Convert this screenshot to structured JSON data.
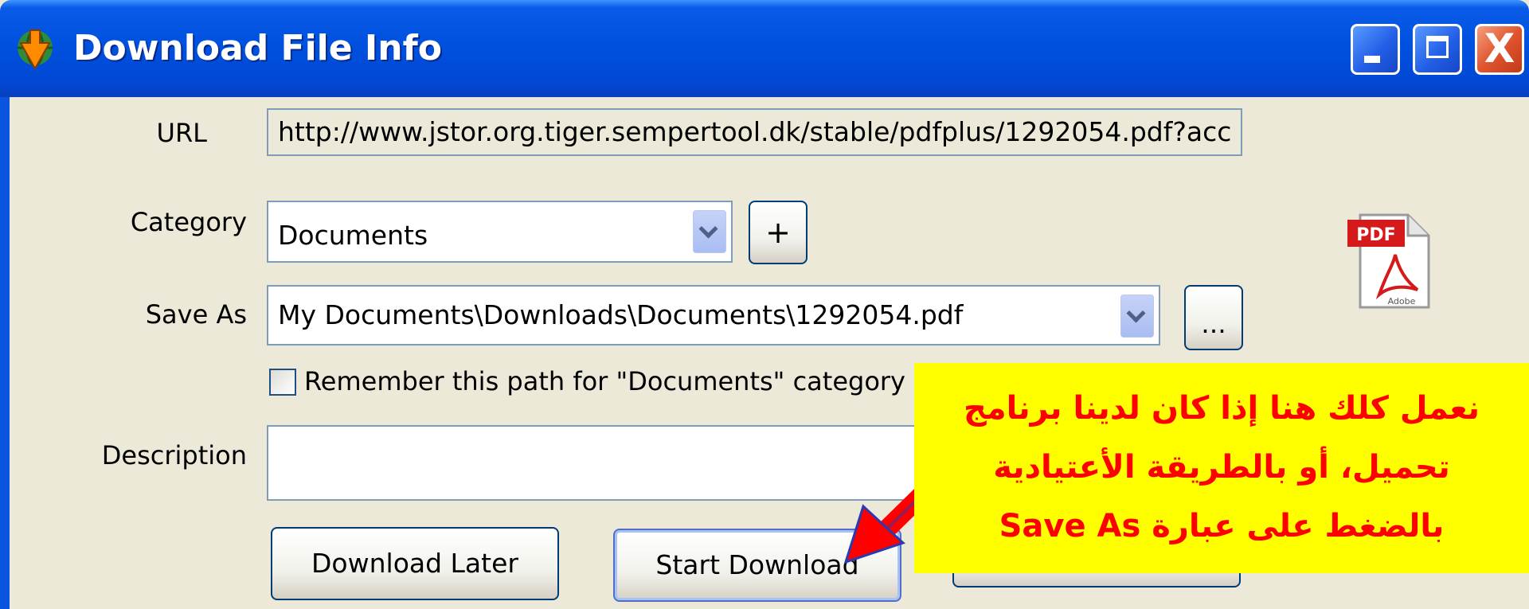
{
  "window": {
    "title": "Download File Info",
    "controls": {
      "minimize": "minimize",
      "maximize": "maximize",
      "close": "X"
    }
  },
  "form": {
    "url": {
      "label": "URL",
      "value": "http://www.jstor.org.tiger.sempertool.dk/stable/pdfplus/1292054.pdf?acc"
    },
    "category": {
      "label": "Category",
      "value": "Documents",
      "add_label": "+"
    },
    "save_as": {
      "label": "Save As",
      "value": "My Documents\\Downloads\\Documents\\1292054.pdf",
      "browse_label": "..."
    },
    "remember": {
      "label": "Remember this path for \"Documents\" category",
      "checked": false
    },
    "description": {
      "label": "Description",
      "value": ""
    }
  },
  "file_icon": {
    "text": "PDF",
    "brand": "Adobe"
  },
  "buttons": {
    "download_later": "Download Later",
    "start_download": "Start Download"
  },
  "callout": {
    "lines": [
      "نعمل كلك هنا إذا كان لدينا برنامج",
      "تحميل، أو بالطريقة الأعتيادية",
      "بالضغط على عبارة Save As"
    ]
  },
  "colors": {
    "titlebar": "#0052e0",
    "window_bg": "#ECE9D8",
    "callout_bg": "#ffff00",
    "callout_text": "#ff0000"
  }
}
